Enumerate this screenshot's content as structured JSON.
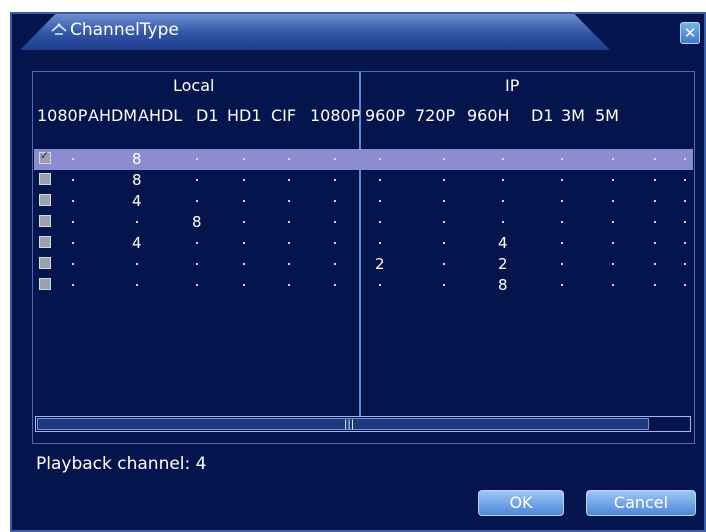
{
  "dialog": {
    "title": "ChannelType",
    "close_icon": "close-icon",
    "title_icon": "tv-icon"
  },
  "groups": {
    "local_label": "Local",
    "ip_label": "IP"
  },
  "columns": {
    "local": [
      "1080P",
      "AHDM",
      "AHDL",
      "D1",
      "HD1",
      "CIF"
    ],
    "ip": [
      "1080P",
      "960P",
      "720P",
      "960H",
      "D1",
      "3M",
      "5M"
    ]
  },
  "rows": [
    {
      "checked": true,
      "selected": true,
      "local": [
        "",
        "8",
        "",
        "",
        "",
        ""
      ],
      "ip": [
        "",
        "",
        "",
        "",
        "",
        "",
        ""
      ]
    },
    {
      "checked": false,
      "selected": false,
      "local": [
        "",
        "8",
        "",
        "",
        "",
        ""
      ],
      "ip": [
        "",
        "",
        "",
        "",
        "",
        "",
        ""
      ]
    },
    {
      "checked": false,
      "selected": false,
      "local": [
        "",
        "4",
        "",
        "",
        "",
        ""
      ],
      "ip": [
        "",
        "",
        "",
        "",
        "",
        "",
        ""
      ]
    },
    {
      "checked": false,
      "selected": false,
      "local": [
        "",
        "",
        "8",
        "",
        "",
        ""
      ],
      "ip": [
        "",
        "",
        "",
        "",
        "",
        "",
        ""
      ]
    },
    {
      "checked": false,
      "selected": false,
      "local": [
        "",
        "4",
        "",
        "",
        "",
        ""
      ],
      "ip": [
        "",
        "",
        "4",
        "",
        "",
        "",
        ""
      ]
    },
    {
      "checked": false,
      "selected": false,
      "local": [
        "",
        "",
        "",
        "",
        "",
        ""
      ],
      "ip": [
        "2",
        "",
        "2",
        "",
        "",
        "",
        ""
      ]
    },
    {
      "checked": false,
      "selected": false,
      "local": [
        "",
        "",
        "",
        "",
        "",
        ""
      ],
      "ip": [
        "",
        "",
        "8",
        "",
        "",
        "",
        ""
      ]
    }
  ],
  "scrollbar": {
    "grip": "|||"
  },
  "status": {
    "playback_label": "Playback channel: 4"
  },
  "buttons": {
    "ok": "OK",
    "cancel": "Cancel"
  },
  "colors": {
    "background": "#04144c",
    "selected_row": "#8c8cd0",
    "accent": "#5e8ad6"
  }
}
